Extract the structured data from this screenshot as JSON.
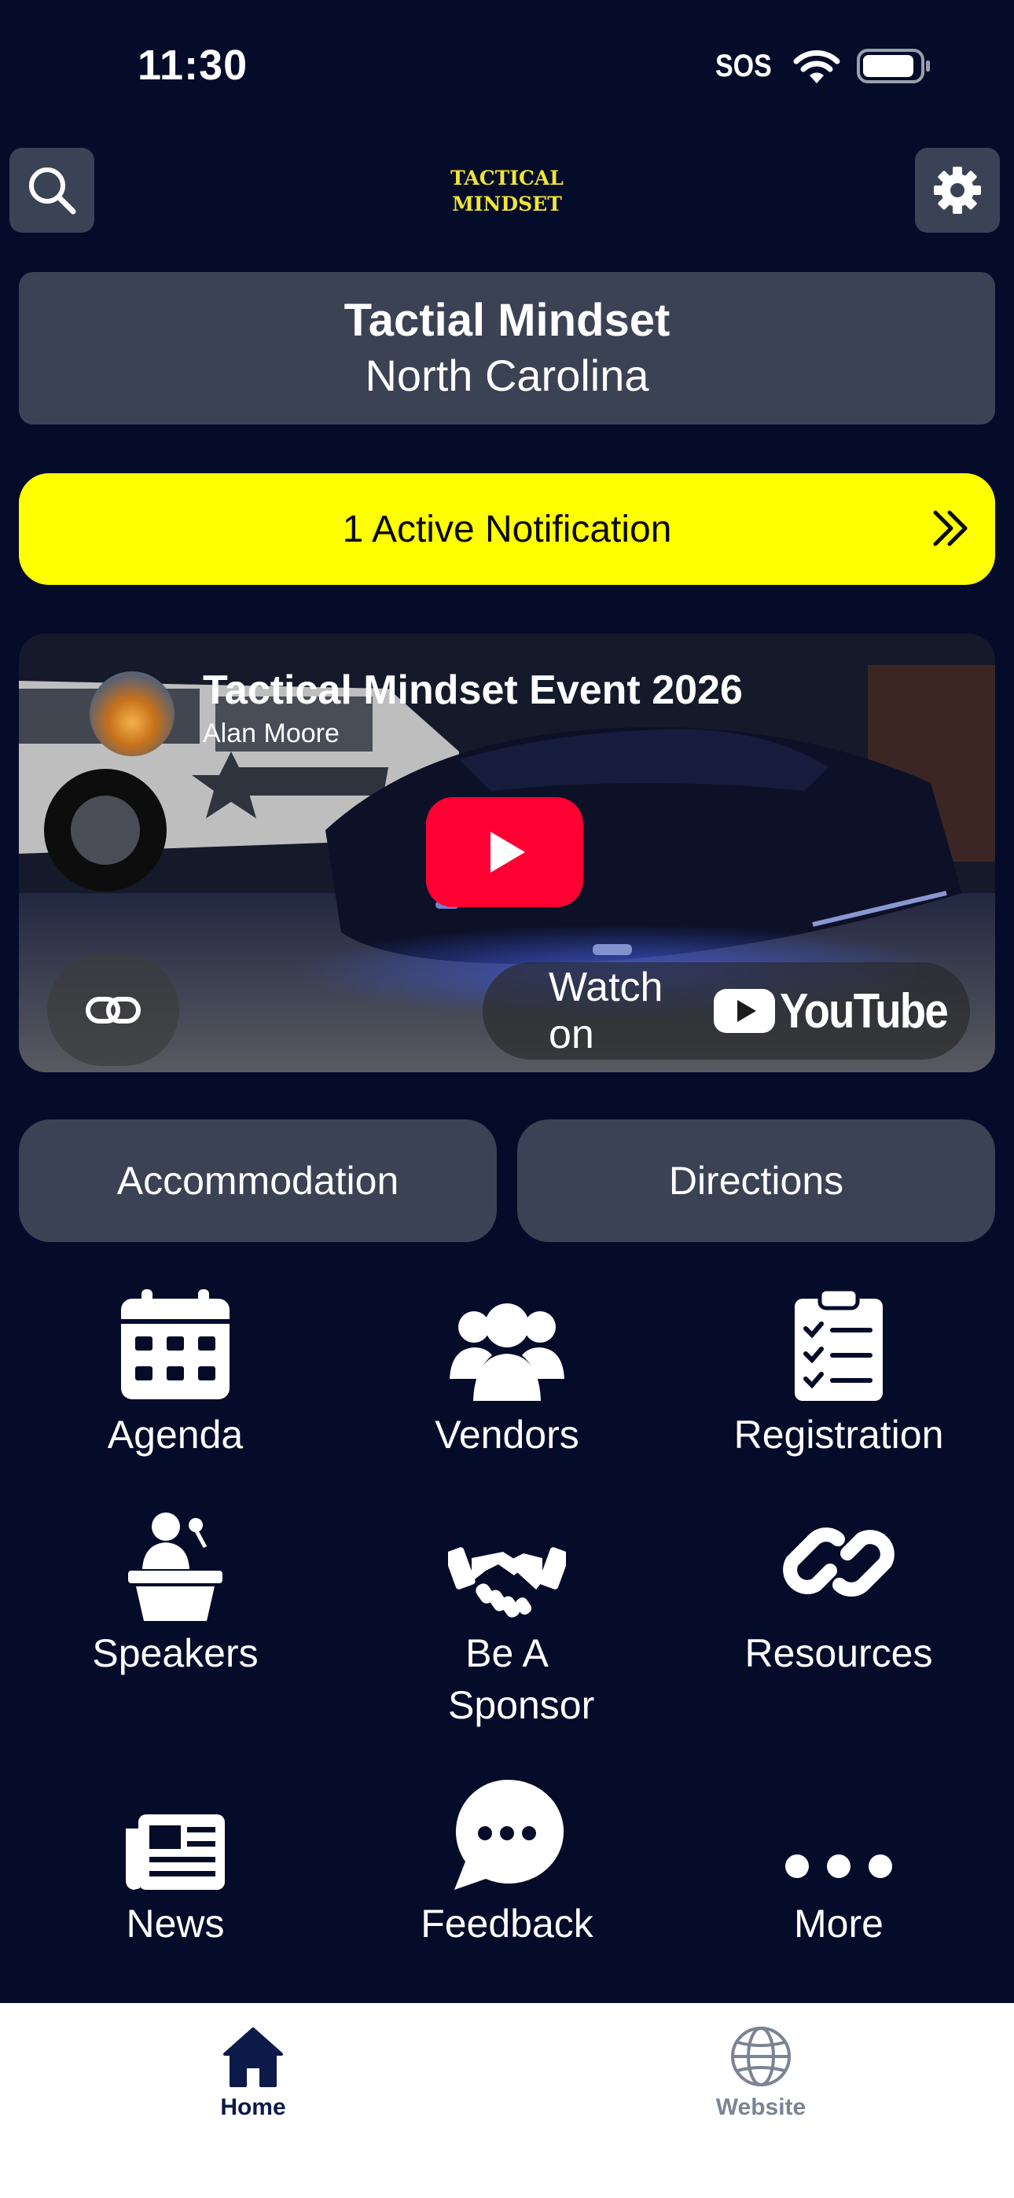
{
  "status_bar": {
    "time": "11:30",
    "sos": "SOS"
  },
  "header": {
    "logo_line1": "TACTICAL",
    "logo_line2": "MINDSET",
    "search_icon": "search-icon",
    "settings_icon": "gear-icon"
  },
  "title_card": {
    "title": "Tactial Mindset",
    "subtitle": "North Carolina"
  },
  "notification": {
    "label": "1 Active Notification",
    "icon": "double-chevron-right-icon",
    "bg": "#ffff00"
  },
  "video": {
    "title": "Tactical Mindset Event 2026",
    "author": "Alan Moore",
    "watch_label": "Watch on",
    "platform": "YouTube"
  },
  "actions": [
    {
      "label": "Accommodation"
    },
    {
      "label": "Directions"
    }
  ],
  "grid": [
    {
      "label": "Agenda",
      "icon": "calendar-icon"
    },
    {
      "label": "Vendors",
      "icon": "users-icon"
    },
    {
      "label": "Registration",
      "icon": "clipboard-checklist-icon"
    },
    {
      "label": "Speakers",
      "icon": "podium-speaker-icon"
    },
    {
      "label": "Be A Sponsor",
      "icon": "handshake-icon"
    },
    {
      "label": "Resources",
      "icon": "link-icon"
    },
    {
      "label": "News",
      "icon": "newspaper-icon"
    },
    {
      "label": "Feedback",
      "icon": "chat-bubble-icon"
    },
    {
      "label": "More",
      "icon": "ellipsis-icon"
    }
  ],
  "tabbar": [
    {
      "label": "Home",
      "icon": "home-icon",
      "active": true
    },
    {
      "label": "Website",
      "icon": "globe-icon",
      "active": false
    }
  ],
  "colors": {
    "background": "#050c2a",
    "card": "#3b4254",
    "accent_yellow": "#ffff00",
    "active_tab": "#0d1b4a",
    "inactive_tab": "#7b8394"
  }
}
